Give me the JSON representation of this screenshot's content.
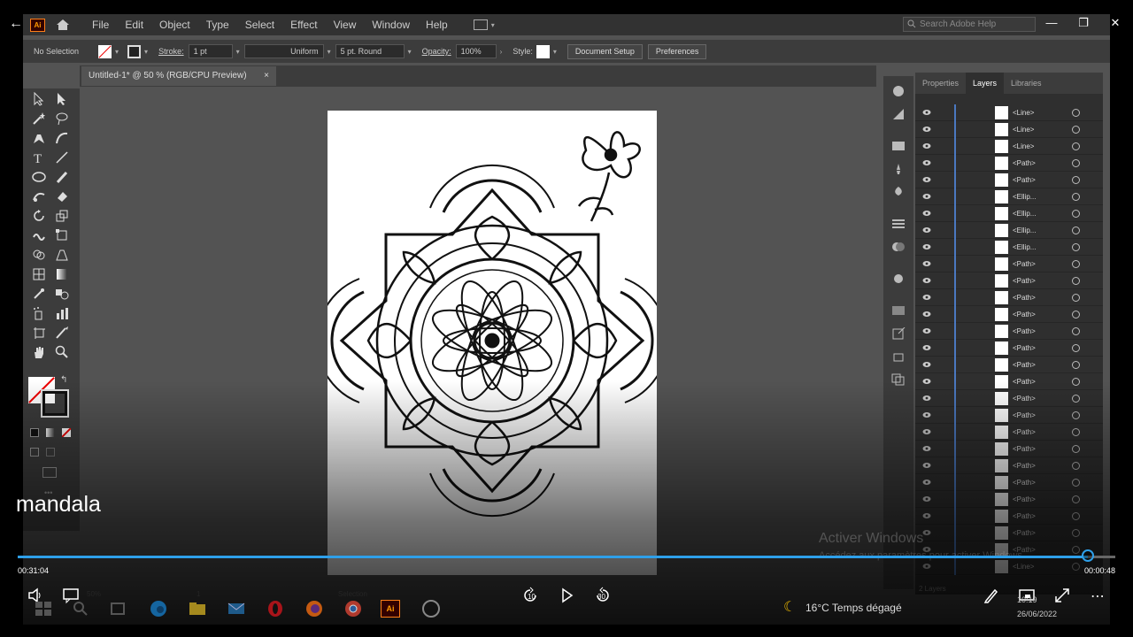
{
  "menubar": {
    "items": [
      "File",
      "Edit",
      "Object",
      "Type",
      "Select",
      "Effect",
      "View",
      "Window",
      "Help"
    ],
    "search_placeholder": "Search Adobe Help",
    "logo_text": "Ai"
  },
  "controlbar": {
    "selection": "No Selection",
    "stroke_label": "Stroke:",
    "stroke_value": "1 pt",
    "profile": "Uniform",
    "brush": "5 pt. Round",
    "opacity_label": "Opacity:",
    "opacity_value": "100%",
    "style_label": "Style:",
    "doc_setup": "Document Setup",
    "preferences": "Preferences"
  },
  "document": {
    "tab_title": "Untitled-1* @ 50 % (RGB/CPU Preview)",
    "zoom": "50%",
    "artboard_num": "1",
    "status": "Selection"
  },
  "layers_panel": {
    "tabs": [
      "Properties",
      "Layers",
      "Libraries"
    ],
    "active_tab": "Layers",
    "rows": [
      "<Line>",
      "<Line>",
      "<Line>",
      "<Path>",
      "<Path>",
      "<Ellip...",
      "<Ellip...",
      "<Ellip...",
      "<Ellip...",
      "<Path>",
      "<Path>",
      "<Path>",
      "<Path>",
      "<Path>",
      "<Path>",
      "<Path>",
      "<Path>",
      "<Path>",
      "<Path>",
      "<Path>",
      "<Path>",
      "<Path>",
      "<Path>",
      "<Path>",
      "<Path>",
      "<Path>",
      "<Path>",
      "<Line>"
    ],
    "footer": "2 Layers"
  },
  "video": {
    "title": "mandala",
    "elapsed": "00:31:04",
    "remaining": "00:00:48",
    "progress": 0.975,
    "rewind_label": "10",
    "forward_label": "30"
  },
  "watermark": {
    "line1": "Activer Windows",
    "line2": "Accédez aux paramètres pour activer Windows."
  },
  "taskbar": {
    "weather": "16°C  Temps dégagé",
    "time": "10:19",
    "date": "26/06/2022"
  },
  "colors": {
    "accent": "#2ea0ea",
    "ui_dark": "#323232",
    "canvas": "#535353",
    "ai_orange": "#ff9a00"
  }
}
